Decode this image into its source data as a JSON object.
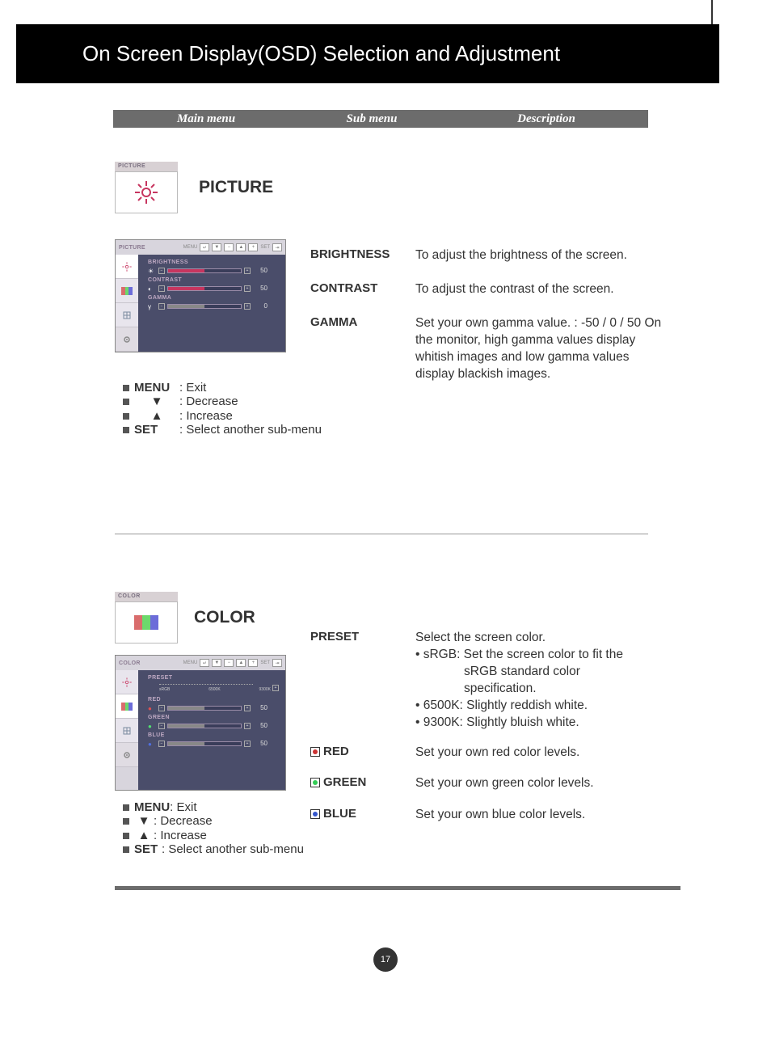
{
  "title": "On Screen Display(OSD) Selection and Adjustment",
  "header": {
    "col1": "Main menu",
    "col2": "Sub menu",
    "col3": "Description"
  },
  "picture": {
    "iconLabel": "PICTURE",
    "title": "PICTURE",
    "osd": {
      "tab": "PICTURE",
      "navMenu": "MENU",
      "navSet": "SET",
      "sliders": [
        {
          "label": "BRIGHTNESS",
          "value": "50",
          "fill": 50
        },
        {
          "label": "CONTRAST",
          "value": "50",
          "fill": 50
        },
        {
          "label": "GAMMA",
          "value": "0",
          "fill": 50
        }
      ]
    },
    "sub": {
      "brightness": {
        "label": "BRIGHTNESS",
        "desc": "To adjust the brightness of the screen."
      },
      "contrast": {
        "label": "CONTRAST",
        "desc": "To adjust the contrast of the screen."
      },
      "gamma": {
        "label": "GAMMA",
        "desc": "Set your own gamma value. : -50 / 0 / 50 On the monitor, high gamma values display whitish images and low gamma values display blackish images."
      }
    },
    "hints": {
      "menu": {
        "key": "MENU",
        "desc": ": Exit"
      },
      "down": {
        "key": "▼",
        "desc": ": Decrease"
      },
      "up": {
        "key": "▲",
        "desc": ": Increase"
      },
      "set": {
        "key": "SET",
        "desc": ": Select another sub-menu"
      }
    }
  },
  "color": {
    "iconLabel": "COLOR",
    "title": "COLOR",
    "osd": {
      "tab": "COLOR",
      "navMenu": "MENU",
      "navSet": "SET",
      "preset": {
        "label": "PRESET",
        "ticks": [
          "sRGB",
          "6500K",
          "9300K"
        ]
      },
      "sliders": [
        {
          "label": "RED",
          "value": "50",
          "fill": 50
        },
        {
          "label": "GREEN",
          "value": "50",
          "fill": 50
        },
        {
          "label": "BLUE",
          "value": "50",
          "fill": 50
        }
      ]
    },
    "sub": {
      "preset": {
        "label": "PRESET",
        "desc_intro": "Select the screen color.",
        "b1a": "• sRGB: Set the screen color to fit the",
        "b1b": "sRGB standard color",
        "b1c": "specification.",
        "b2": "• 6500K: Slightly reddish white.",
        "b3": "• 9300K: Slightly bluish white."
      },
      "red": {
        "label": "RED",
        "desc": "Set your own red color levels."
      },
      "green": {
        "label": "GREEN",
        "desc": "Set your own green color levels."
      },
      "blue": {
        "label": "BLUE",
        "desc": "Set your own blue color levels."
      }
    },
    "hints": {
      "menu": {
        "key": "MENU",
        "desc": ": Exit"
      },
      "down": {
        "key": "▼",
        "desc": ": Decrease"
      },
      "up": {
        "key": "▲",
        "desc": ": Increase"
      },
      "set": {
        "key": "SET",
        "desc": ": Select another sub-menu"
      }
    }
  },
  "pageNumber": "17"
}
